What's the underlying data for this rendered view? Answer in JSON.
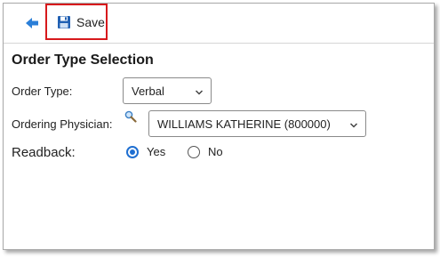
{
  "toolbar": {
    "back_icon": "back-arrow-icon",
    "save_icon": "floppy-disk-icon",
    "save_label": "Save",
    "highlight_color": "#d7191c"
  },
  "section": {
    "title": "Order Type Selection"
  },
  "order_type": {
    "label": "Order Type:",
    "value": "Verbal"
  },
  "ordering_physician": {
    "label": "Ordering Physician:",
    "search_icon": "magnifier-icon",
    "value": "WILLIAMS KATHERINE (800000)"
  },
  "readback": {
    "label": "Readback:",
    "options": [
      {
        "label": "Yes",
        "selected": true
      },
      {
        "label": "No",
        "selected": false
      }
    ],
    "accent_color": "#1f6fd1"
  }
}
